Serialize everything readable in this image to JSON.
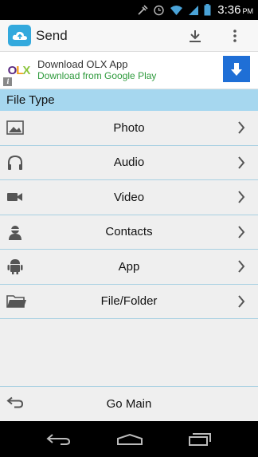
{
  "status_bar": {
    "time": "3:36",
    "ampm": "PM"
  },
  "action_bar": {
    "title": "Send"
  },
  "ad": {
    "logo_text": "OLX",
    "info_glyph": "i",
    "line1": "Download OLX App",
    "line2": "Download from Google Play",
    "accent": "#1f6fd6"
  },
  "section": {
    "title": "File Type"
  },
  "items": [
    {
      "label": "Photo",
      "icon": "image-icon"
    },
    {
      "label": "Audio",
      "icon": "headphones-icon"
    },
    {
      "label": "Video",
      "icon": "video-camera-icon"
    },
    {
      "label": "Contacts",
      "icon": "contact-person-icon"
    },
    {
      "label": "App",
      "icon": "android-icon"
    },
    {
      "label": "File/Folder",
      "icon": "folder-icon"
    }
  ],
  "bottom": {
    "label": "Go Main",
    "icon": "back-arrow-icon"
  },
  "colors": {
    "header": "#a6d7ef",
    "divider": "#a8d0e2",
    "brand": "#33a9dd"
  }
}
